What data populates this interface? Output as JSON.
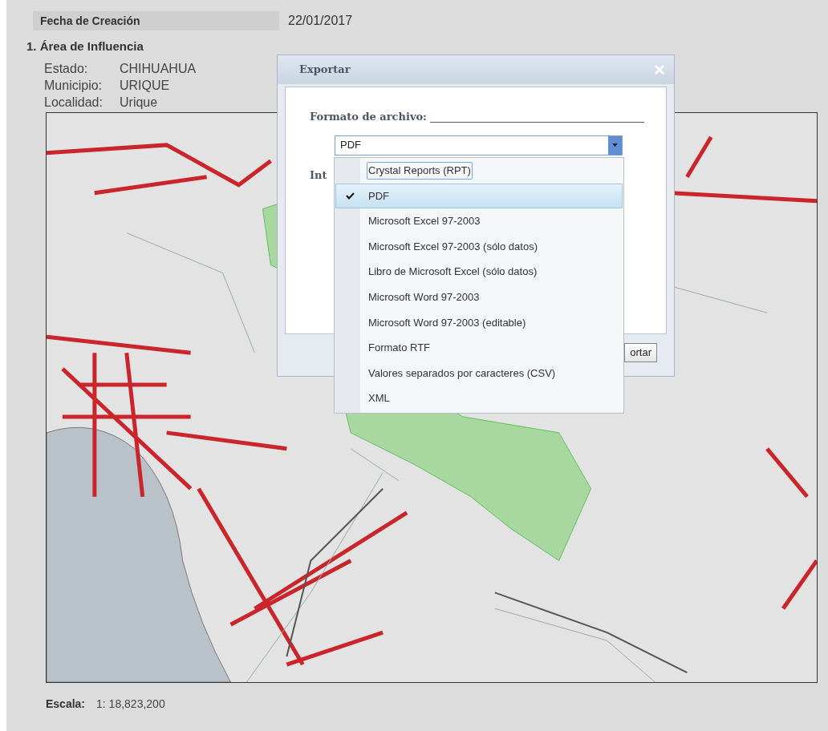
{
  "header": {
    "label": "Fecha de Creación",
    "value": "22/01/2017"
  },
  "section": {
    "title": "1. Área de Influencia",
    "fields": [
      {
        "label": "Estado:",
        "value": "CHIHUAHUA"
      },
      {
        "label": "Municipio:",
        "value": "URIQUE"
      },
      {
        "label": "Localidad:",
        "value": "Urique"
      }
    ]
  },
  "scale": {
    "label": "Escala:",
    "value": "1: 18,823,200"
  },
  "dialog": {
    "title": "Exportar",
    "format_label": "Formato de archivo:",
    "select_value": "PDF",
    "hidden_label": "Int",
    "button": "ortar",
    "options": [
      {
        "label": "Crystal Reports (RPT)",
        "selected": false,
        "focused": true
      },
      {
        "label": "PDF",
        "selected": true,
        "focused": false
      },
      {
        "label": "Microsoft Excel 97-2003",
        "selected": false,
        "focused": false
      },
      {
        "label": "Microsoft Excel 97-2003 (sólo datos)",
        "selected": false,
        "focused": false
      },
      {
        "label": "Libro de Microsoft Excel (sólo datos)",
        "selected": false,
        "focused": false
      },
      {
        "label": "Microsoft Word 97-2003",
        "selected": false,
        "focused": false
      },
      {
        "label": "Microsoft Word 97-2003 (editable)",
        "selected": false,
        "focused": false
      },
      {
        "label": "Formato RTF",
        "selected": false,
        "focused": false
      },
      {
        "label": "Valores separados por caracteres (CSV)",
        "selected": false,
        "focused": false
      },
      {
        "label": "XML",
        "selected": false,
        "focused": false
      }
    ]
  }
}
